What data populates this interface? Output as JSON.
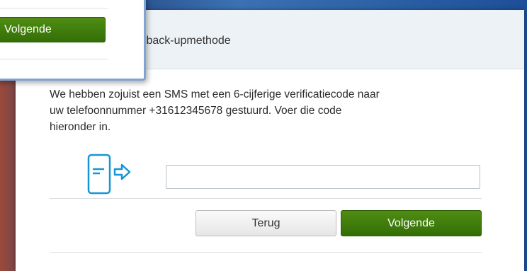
{
  "dialog": {
    "title": "s back-upmethode",
    "message": "We hebben zojuist een SMS met een 6-cijferige verificatiecode naar uw telefoonnummer +31612345678 gestuurd. Voer die code hieronder in.",
    "code_value": "",
    "back_label": "Terug",
    "next_label": "Volgende"
  },
  "popup": {
    "next_label": "Volgende"
  },
  "colors": {
    "accent_green": "#3f7d0c",
    "icon_blue": "#1596d6"
  },
  "icons": {
    "phone": "phone-sms-arrow-icon"
  }
}
